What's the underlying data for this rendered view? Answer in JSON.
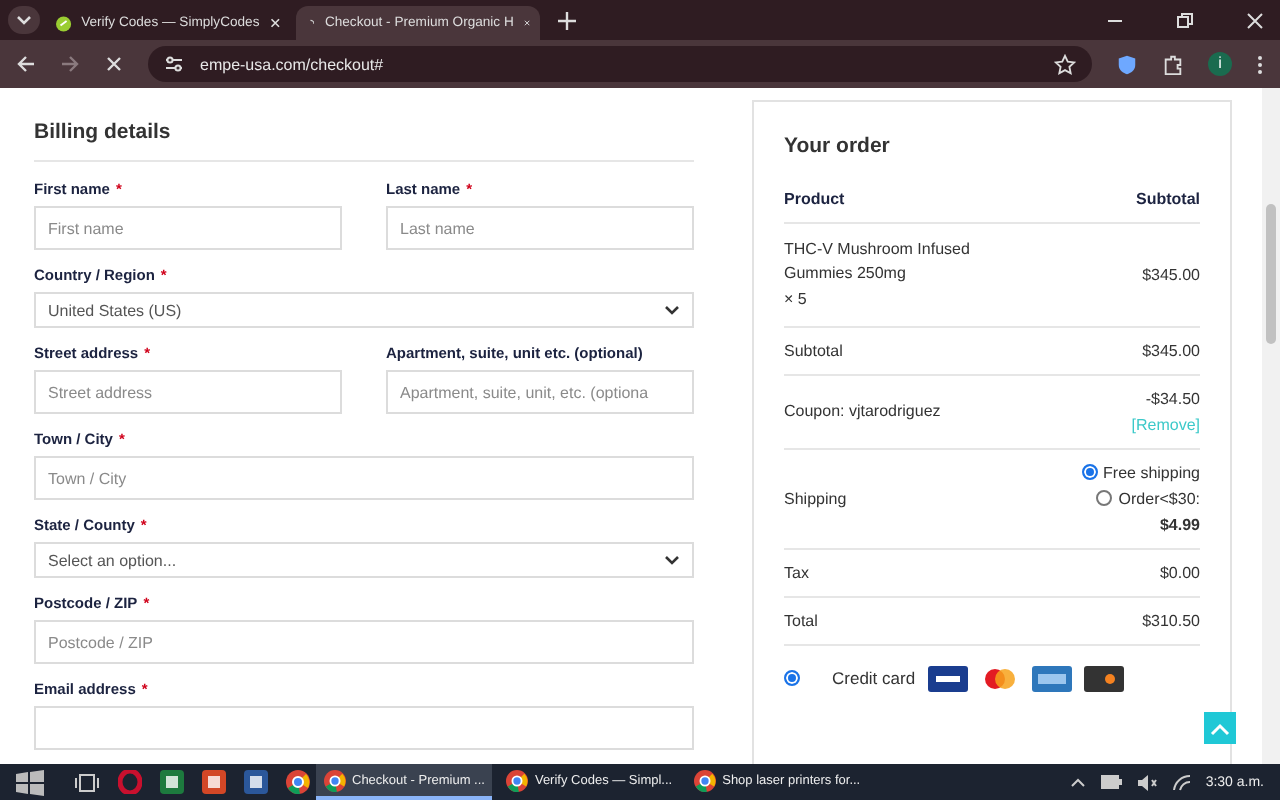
{
  "browser": {
    "tabs": [
      {
        "title": "Verify Codes — SimplyCodes",
        "kind": "loaded",
        "selected": false
      },
      {
        "title": "Checkout - Premium Organic H",
        "kind": "loading",
        "selected": true
      }
    ],
    "address": "empe-usa.com/checkout#",
    "profile_initial": "i"
  },
  "billing": {
    "title": "Billing details",
    "rows": [
      [
        {
          "kind": "text",
          "label": "First name",
          "required_mark": "*",
          "placeholder": "First name"
        },
        {
          "kind": "text",
          "label": "Last name",
          "required_mark": "*",
          "placeholder": "Last name"
        }
      ],
      [
        {
          "kind": "select",
          "label": "Country / Region",
          "required_mark": "*",
          "value": "United States (US)"
        }
      ],
      [
        {
          "kind": "text",
          "label": "Street address",
          "required_mark": "*",
          "placeholder": "Street address"
        },
        {
          "kind": "text",
          "label": "Apartment, suite, unit etc. (optional)",
          "placeholder": "Apartment, suite, unit, etc. (optiona"
        }
      ],
      [
        {
          "kind": "text",
          "label": "Town / City",
          "required_mark": "*",
          "placeholder": "Town / City"
        }
      ],
      [
        {
          "kind": "select",
          "label": "State / County",
          "required_mark": "*",
          "value": "Select an option..."
        }
      ],
      [
        {
          "kind": "text",
          "label": "Postcode / ZIP",
          "required_mark": "*",
          "placeholder": "Postcode / ZIP"
        }
      ],
      [
        {
          "kind": "text",
          "label": "Email address",
          "required_mark": "*"
        }
      ]
    ]
  },
  "order": {
    "title": "Your order",
    "columns": [
      "Product",
      "Subtotal"
    ],
    "rows": [
      {
        "kind": "product",
        "label": "THC-V Mushroom Infused Gummies 250mg",
        "quantity": "× 5",
        "amount": "$345.00"
      },
      {
        "kind": "plain",
        "label": "Subtotal",
        "amount": "$345.00"
      },
      {
        "kind": "coupon",
        "label": "Coupon: vjtarodriguez",
        "amount": "-$34.50",
        "link": "[Remove]"
      },
      {
        "kind": "shipping",
        "label": "Shipping",
        "options": [
          {
            "label": "Free shipping",
            "selected": true
          },
          {
            "label": "Order<$30:",
            "price": "$4.99",
            "selected": false
          }
        ]
      },
      {
        "kind": "plain",
        "label": "Tax",
        "amount": "$0.00"
      },
      {
        "kind": "plain",
        "label": "Total",
        "amount": "$310.50"
      }
    ],
    "payment": {
      "label": "Credit card",
      "selected": true
    }
  },
  "taskbar": {
    "pinned": [
      {
        "kind": "task-view"
      },
      {
        "kind": "opera"
      },
      {
        "kind": "excel"
      },
      {
        "kind": "powerpoint"
      },
      {
        "kind": "word"
      },
      {
        "kind": "chrome"
      }
    ],
    "tasks": [
      {
        "title": "Checkout - Premium ...",
        "selected": true
      },
      {
        "title": "Verify Codes — Simpl...",
        "selected": false
      },
      {
        "title": "Shop laser printers for...",
        "selected": false
      }
    ],
    "time": "3:30 a.m."
  }
}
